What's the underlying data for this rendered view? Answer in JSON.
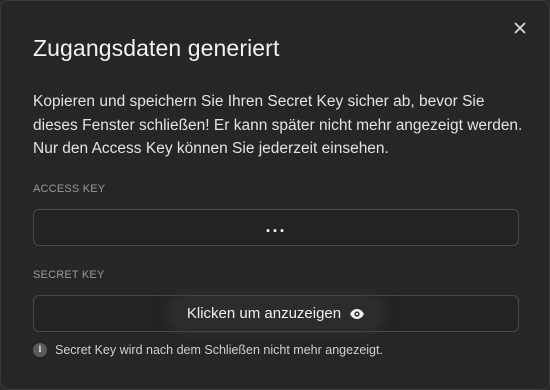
{
  "dialog": {
    "title": "Zugangsdaten generiert",
    "description": "Kopieren und speichern Sie Ihren Secret Key sicher ab, bevor Sie dieses Fenster schließen! Er kann später nicht mehr angezeigt werden. Nur den Access Key können Sie jederzeit einsehen.",
    "close_icon": "close-icon"
  },
  "access_key": {
    "label": "ACCESS KEY",
    "value": "..."
  },
  "secret_key": {
    "label": "SECRET KEY",
    "reveal_label": "Klicken um anzuzeigen",
    "reveal_icon": "eye-icon"
  },
  "hint": {
    "icon": "info-icon",
    "text": "Secret Key wird nach dem Schließen nicht mehr angezeigt."
  },
  "colors": {
    "background": "#262626",
    "border": "#4a4a4a",
    "text": "#e6e6e6",
    "muted": "#9a9a9a"
  }
}
